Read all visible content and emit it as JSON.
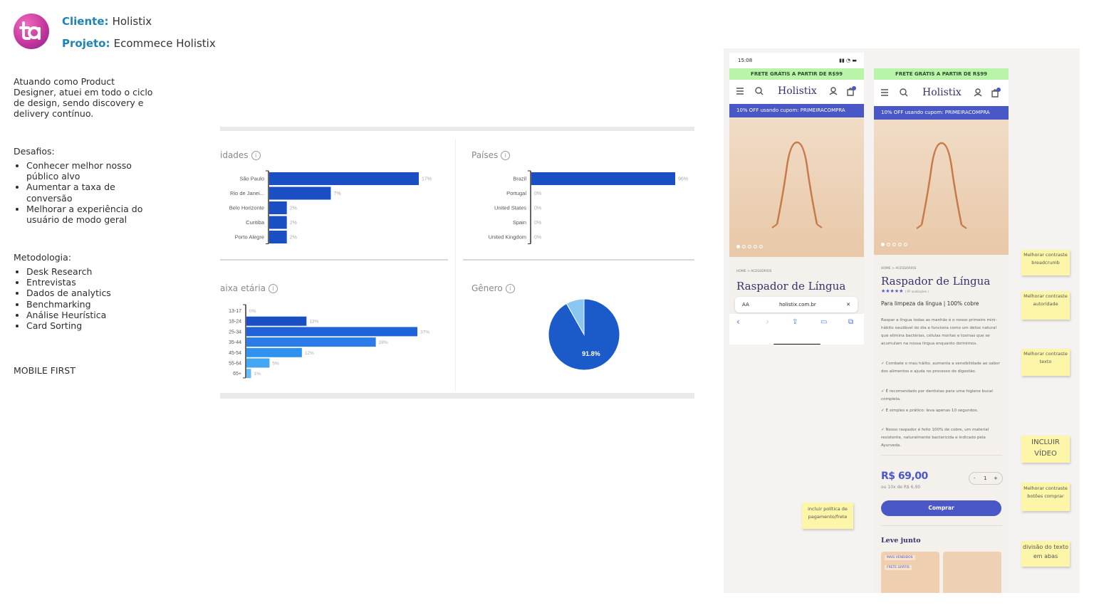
{
  "client": {
    "label": "Cliente:",
    "value": "Holistix"
  },
  "project": {
    "label": "Projeto:",
    "value": "Ecommece Holistix"
  },
  "intro": "Atuando como Product Designer, atuei em todo o ciclo de design, sendo discovery e delivery contínuo.",
  "challenges": {
    "title": "Desafios:",
    "items": [
      "Conhecer melhor nosso público alvo",
      "Aumentar a taxa de conversão",
      "Melhorar a experiência do usuário de modo geral"
    ]
  },
  "methodology": {
    "title": "Metodologia:",
    "items": [
      "Desk Research",
      "Entrevistas",
      "Dados de analytics",
      "Benchmarking",
      "Análise Heurística",
      "Card Sorting"
    ]
  },
  "mobile_first": "MOBILE FIRST",
  "chart_data": [
    {
      "type": "bar",
      "title": "idades",
      "categories": [
        "São Paulo",
        "Rio de Janei...",
        "Belo Horizonte",
        "Curitiba",
        "Porto Alegre"
      ],
      "values": [
        17,
        7,
        2,
        2,
        2
      ],
      "value_labels": [
        "17%",
        "7%",
        "2%",
        "2%",
        "2%"
      ],
      "color": "#1a4fc4"
    },
    {
      "type": "bar",
      "title": "Países",
      "categories": [
        "Brazil",
        "Portugal",
        "United States",
        "Spain",
        "United Kingdom"
      ],
      "values": [
        96,
        0,
        0,
        0,
        0
      ],
      "value_labels": [
        "96%",
        "0%",
        "0%",
        "0%",
        "0%"
      ],
      "color": "#1a4fc4"
    },
    {
      "type": "bar",
      "title": "aixa etária",
      "categories": [
        "13-17",
        "18-24",
        "25-34",
        "35-44",
        "45-54",
        "55-64",
        "65+"
      ],
      "values": [
        0,
        13,
        37,
        28,
        12,
        5,
        1
      ],
      "value_labels": [
        "0%",
        "13%",
        "37%",
        "28%",
        "12%",
        "5%",
        "1%"
      ],
      "colors": [
        "#1a4fc4",
        "#1a4fc4",
        "#1e64d8",
        "#2b7ce6",
        "#2f92ee",
        "#42a6f3",
        "#6ab9f7"
      ]
    },
    {
      "type": "pie",
      "title": "Gênero",
      "slices": [
        {
          "value": 91.8,
          "label": "91.8%",
          "color": "#1a5bc9"
        },
        {
          "value": 8.2,
          "label": "",
          "color": "#8ac6f2"
        }
      ]
    }
  ],
  "phone1": {
    "time": "15:08",
    "shipping_banner": "FRETE GRÁTIS A PARTIR DE R$99",
    "brand": "Holistix",
    "coupon": "10% OFF usando cupom: PRIMEIRACOMPRA",
    "breadcrumb": "HOME  >  ACESSÓRIOS",
    "product_title": "Raspador de Língua",
    "url": "holistix.com.br",
    "aa": "AA",
    "close": "✕"
  },
  "phone2": {
    "shipping_banner": "FRETE GRÁTIS A PARTIR DE R$99",
    "brand": "Holistix",
    "coupon": "10% OFF usando cupom: PRIMEIRACOMPRA",
    "breadcrumb": "HOME  >  ACESSÓRIOS",
    "product_title": "Raspador de Língua",
    "rating": "★★★★★",
    "reviews": "( 97 avaliações )",
    "subtitle": "Para limpeza da língua | 100% cobre",
    "description": "Raspar a língua todas as manhãs é o nosso primeiro mini-hábito saudável do dia e funciona como um detox natural que elimina bactérias, células mortas e toxinas que se acumulam na nossa língua enquanto dormimos.",
    "bullets": [
      "✓ Combate o mau hálito, aumenta a sensibilidade ao sabor dos alimentos e ajuda no processo de digestão.",
      "✓ É recomendado por dentistas para uma higiene bucal completa.",
      "✓ É simples e prático: leva apenas 10 segundos.",
      "✓ Nosso raspador é feito 100% de cobre, um material resistente, naturalmente bactericida e indicado pela Ayurveda."
    ],
    "price": "R$ 69,00",
    "installments": "ou 10x de R$ 6,90",
    "qty_minus": "-",
    "qty": "1",
    "qty_plus": "+",
    "buy_label": "Comprar",
    "leve_junto": "Leve junto",
    "tag_bestseller": "MAIS VENDIDOS",
    "tag_free": "FRETE GRÁTIS"
  },
  "stickies": {
    "payment": "incluir política de pagamento/frete",
    "breadcrumb": "Melhorar contraste breadcrumb",
    "authority": "Melhorar contraste autoridade",
    "text": "Melhorar contraste texto",
    "video": "INCLUIR VÍDEO",
    "buttons": "Melhorar contraste botões comprar",
    "tabs": "divisão do texto em abas"
  }
}
